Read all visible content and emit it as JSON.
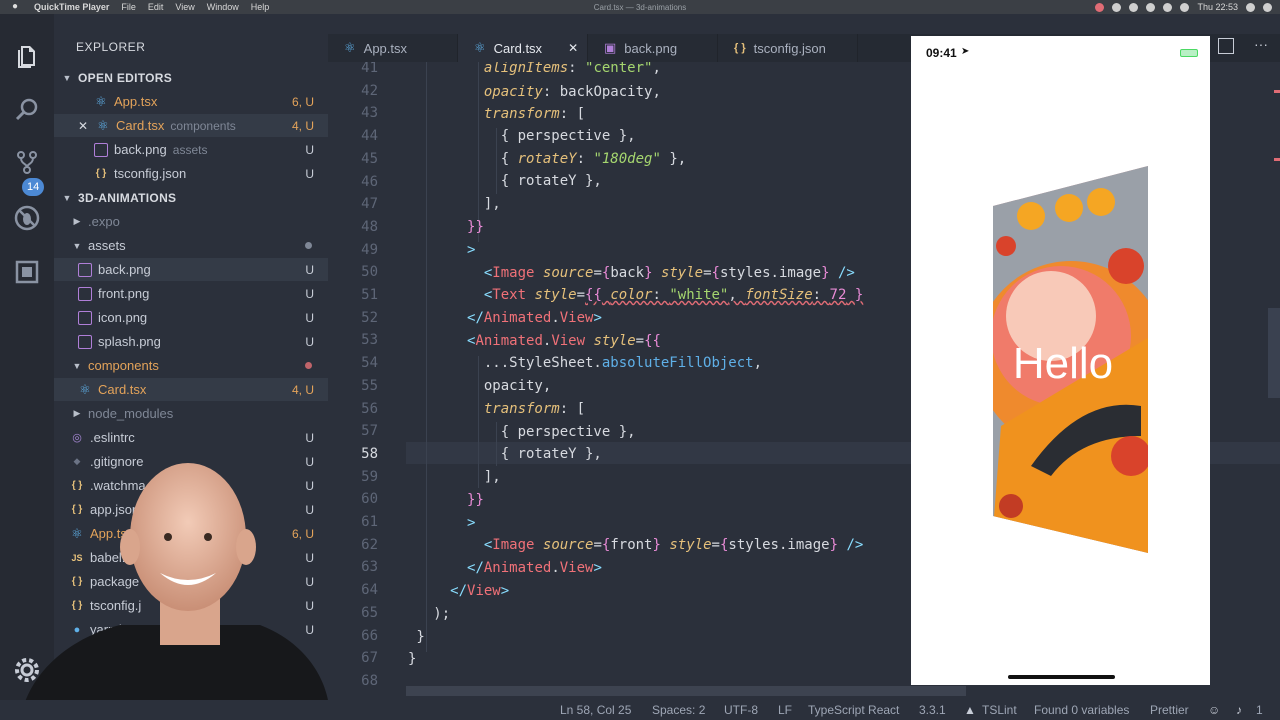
{
  "menubar": {
    "app": "QuickTime Player",
    "items": [
      "File",
      "Edit",
      "View",
      "Window",
      "Help"
    ],
    "window_title": "Card.tsx — 3d-animations",
    "clock": "Thu 22:53"
  },
  "activity": {
    "scm_badge": "14"
  },
  "explorer": {
    "title": "EXPLORER",
    "open_editors": {
      "label": "OPEN EDITORS",
      "items": [
        {
          "name": "App.tsx",
          "desc": "",
          "status": "6, U"
        },
        {
          "name": "Card.tsx",
          "desc": "components",
          "status": "4, U"
        },
        {
          "name": "back.png",
          "desc": "assets",
          "status": "U"
        },
        {
          "name": "tsconfig.json",
          "desc": "",
          "status": "U"
        }
      ]
    },
    "project": {
      "label": "3D-ANIMATIONS",
      "items": [
        {
          "name": ".expo",
          "status": ""
        },
        {
          "name": "assets",
          "status": ""
        },
        {
          "name": "back.png",
          "status": "U"
        },
        {
          "name": "front.png",
          "status": "U"
        },
        {
          "name": "icon.png",
          "status": "U"
        },
        {
          "name": "splash.png",
          "status": "U"
        },
        {
          "name": "components",
          "status": ""
        },
        {
          "name": "Card.tsx",
          "status": "4, U"
        },
        {
          "name": "node_modules",
          "status": ""
        },
        {
          "name": ".eslintrc",
          "status": "U"
        },
        {
          "name": ".gitignore",
          "status": "U"
        },
        {
          "name": ".watchma",
          "status": "U"
        },
        {
          "name": "app.json",
          "status": "U"
        },
        {
          "name": "App.tsx",
          "status": "6, U"
        },
        {
          "name": "babel.c",
          "status": "U"
        },
        {
          "name": "package",
          "status": "U"
        },
        {
          "name": "tsconfig.j",
          "status": "U"
        },
        {
          "name": "yarn.l",
          "status": "U"
        }
      ]
    }
  },
  "tabs": [
    "App.tsx",
    "Card.tsx",
    "back.png",
    "tsconfig.json"
  ],
  "editor": {
    "line_numbers": [
      "41",
      "42",
      "43",
      "44",
      "45",
      "46",
      "47",
      "48",
      "49",
      "50",
      "51",
      "52",
      "53",
      "54",
      "55",
      "56",
      "57",
      "58",
      "59",
      "60",
      "61",
      "62",
      "63",
      "64",
      "65",
      "66",
      "67",
      "68"
    ],
    "current_line": "58"
  },
  "simulator": {
    "time": "09:41",
    "card_text": "Hello"
  },
  "statusbar": {
    "position": "Ln 58, Col 25",
    "spaces": "Spaces: 2",
    "encoding": "UTF-8",
    "eol": "LF",
    "language": "TypeScript React",
    "version": "3.3.1",
    "lint": "TSLint",
    "variables": "Found 0 variables",
    "formatter": "Prettier",
    "notifications": "1"
  },
  "colors": {
    "accent_badge": "#4c89d4",
    "modified": "#e3a35a",
    "error": "#e06c75"
  }
}
